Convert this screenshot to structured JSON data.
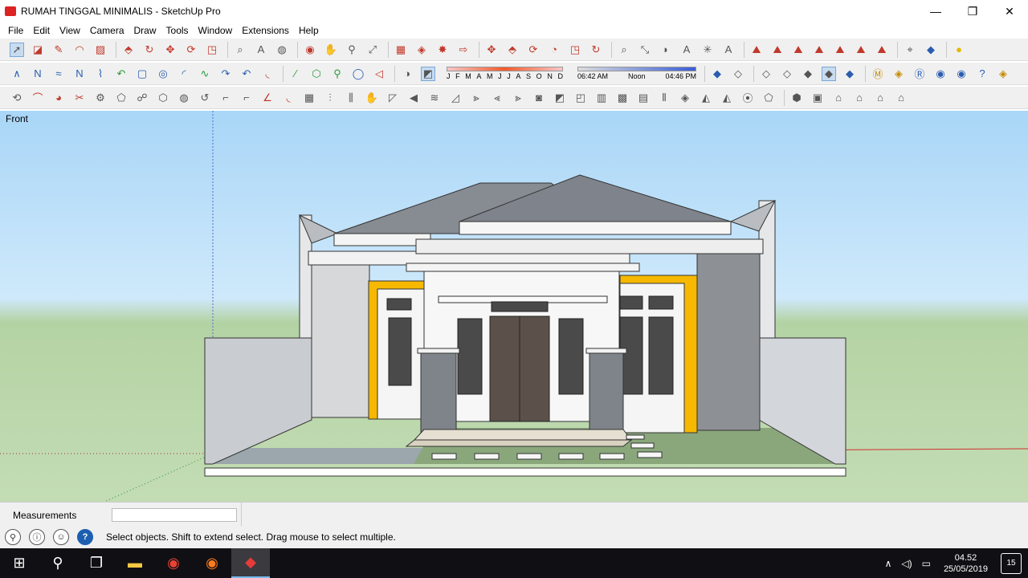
{
  "app": {
    "title": "RUMAH TINGGAL MINIMALIS - SketchUp Pro"
  },
  "window_controls": {
    "minimize": "—",
    "maximize": "❐",
    "close": "✕"
  },
  "menu": [
    "File",
    "Edit",
    "View",
    "Camera",
    "Draw",
    "Tools",
    "Window",
    "Extensions",
    "Help"
  ],
  "shadow_settings": {
    "months": [
      "J",
      "F",
      "M",
      "A",
      "M",
      "J",
      "J",
      "A",
      "S",
      "O",
      "N",
      "D"
    ],
    "time_start": "06:42 AM",
    "time_mid": "Noon",
    "time_end": "04:46 PM"
  },
  "viewport": {
    "view_name": "Front"
  },
  "measurements": {
    "label": "Measurements",
    "value": ""
  },
  "status": {
    "hint": "Select objects. Shift to extend select. Drag mouse to select multiple."
  },
  "taskbar": {
    "time": "04.52",
    "date": "25/05/2019",
    "notifications": "15"
  },
  "colors": {
    "accent_yellow": "#f6b800",
    "sky": "#a9d6f7",
    "grass": "#b4d3a4",
    "taskbar": "#101014"
  }
}
